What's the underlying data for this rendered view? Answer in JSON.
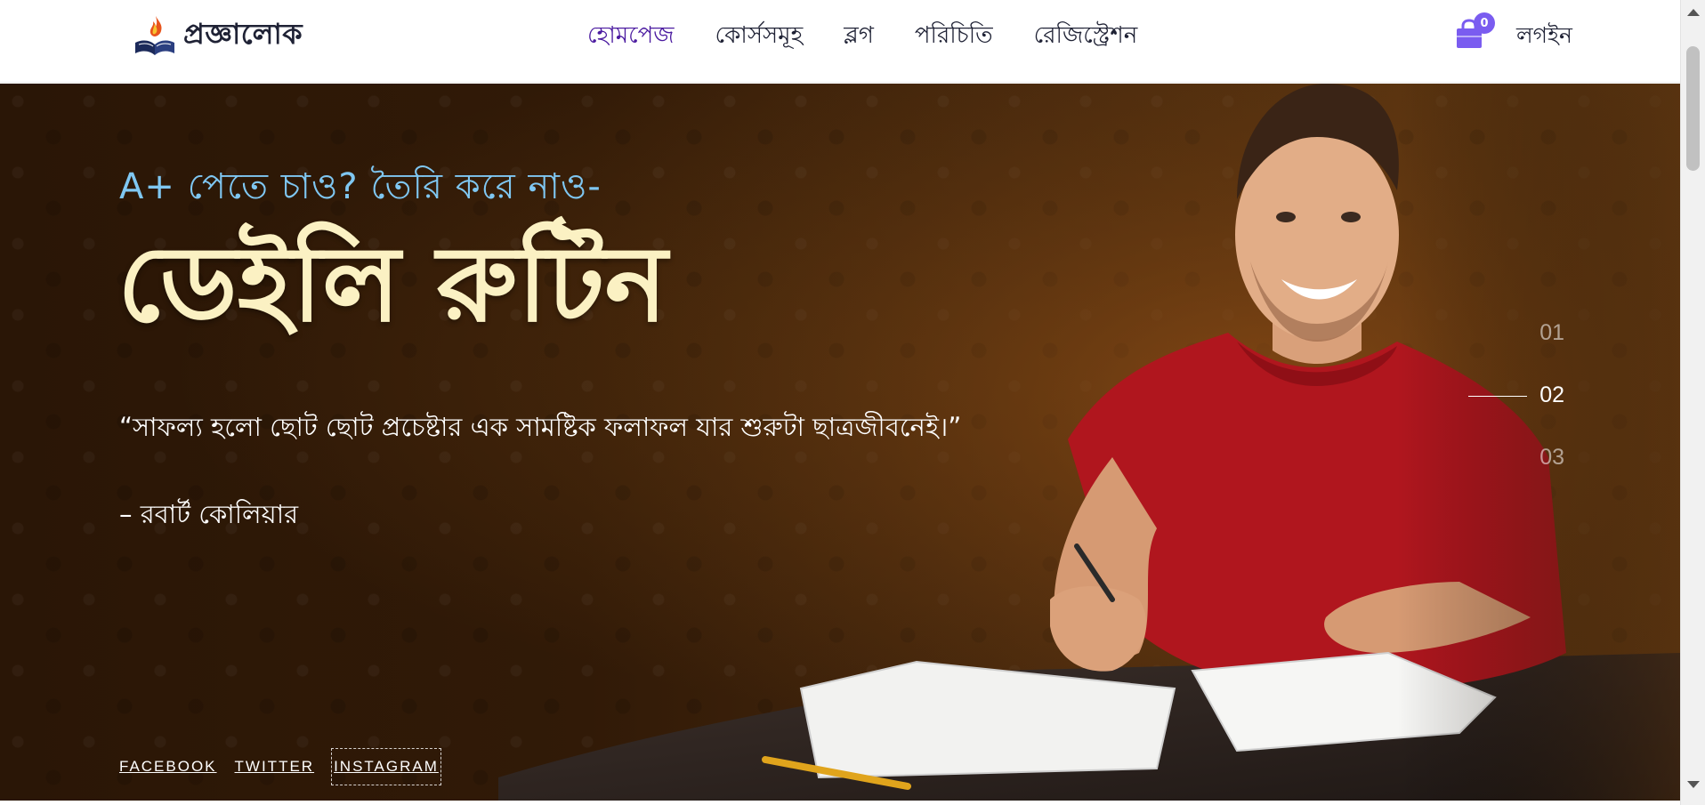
{
  "brand": {
    "name": "প্রজ্ঞালোক",
    "logo_icon": "book-flame-icon"
  },
  "nav": {
    "items": [
      {
        "label": "হোমপেজ",
        "active": true
      },
      {
        "label": "কোর্সসমূহ",
        "active": false
      },
      {
        "label": "ব্লগ",
        "active": false
      },
      {
        "label": "পরিচিতি",
        "active": false
      },
      {
        "label": "রেজিস্ট্রেশন",
        "active": false
      }
    ],
    "cart": {
      "icon": "shopping-bag-icon",
      "count": "0"
    },
    "login_label": "লগইন"
  },
  "hero": {
    "kicker": "A+ পেতে চাও? তৈরি করে নাও-",
    "headline": "ডেইলি রুটিন",
    "quote": "“সাফল্য হলো ছোট ছোট প্রচেষ্টার এক সামষ্টিক ফলাফল যার শুরুটা ছাত্রজীবনেই।”",
    "author": "– রবার্ট কোলিয়ার"
  },
  "slider": {
    "items": [
      "01",
      "02",
      "03"
    ],
    "active_index": 1
  },
  "social": {
    "facebook": "FACEBOOK",
    "twitter": "TWITTER",
    "instagram": "INSTAGRAM"
  },
  "colors": {
    "accent": "#4b1ba0",
    "badge": "#7a5cf0",
    "kicker": "#7fc7f2",
    "headline": "#fbf1c3"
  }
}
